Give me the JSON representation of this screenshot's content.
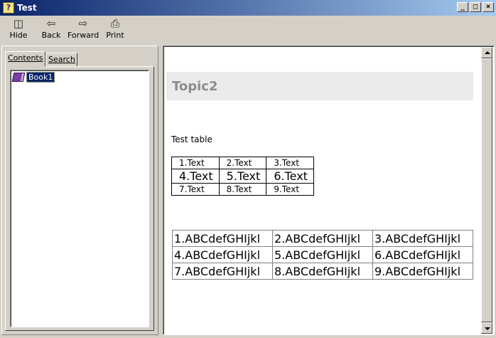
{
  "window": {
    "title": "Test",
    "controls": {
      "minimize": "_",
      "maximize": "□",
      "close": "×"
    }
  },
  "toolbar": {
    "hide_label": "Hide",
    "back_label": "Back",
    "forward_label": "Forward",
    "print_label": "Print",
    "icons": {
      "hide": "hide-pane-icon",
      "back": "back-arrow-icon",
      "forward": "forward-arrow-icon",
      "print": "printer-icon"
    }
  },
  "navigation": {
    "tabs": [
      {
        "label": "Contents",
        "selected": true
      },
      {
        "label": "Search",
        "selected": false
      }
    ],
    "tree": [
      {
        "label": "Book1",
        "icon": "book-icon",
        "selected": true
      }
    ]
  },
  "content": {
    "topic_title": "Topic2",
    "caption": "Test table",
    "table1": [
      [
        "1.Text",
        "2.Text",
        "3.Text"
      ],
      [
        "4.Text",
        "5.Text",
        "6.Text"
      ],
      [
        "7.Text",
        "8.Text",
        "9.Text"
      ]
    ],
    "table2": [
      [
        "1.ABCdefGHIjkl",
        "2.ABCdefGHIjkl",
        "3.ABCdefGHIjkl"
      ],
      [
        "4.ABCdefGHIjkl",
        "5.ABCdefGHIjkl",
        "6.ABCdefGHIjkl"
      ],
      [
        "7.ABCdefGHIjkl",
        "8.ABCdefGHIjkl",
        "9.ABCdefGHIjkl"
      ]
    ]
  },
  "colors": {
    "titlebar_start": "#0a246a",
    "titlebar_end": "#a6caf0",
    "chrome": "#d4d0c8",
    "topic_header_bg": "#ebebeb",
    "topic_title": "#8c8c8c",
    "selection": "#0a246a"
  }
}
